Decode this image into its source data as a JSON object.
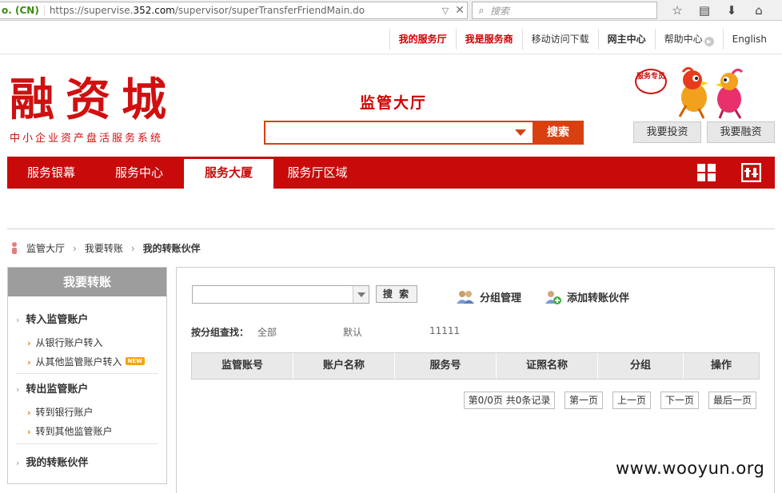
{
  "browser": {
    "cert_label": "o. (CN)",
    "url_prefix": "https://supervise.",
    "url_domain": "352.com",
    "url_suffix": "/supervisor/superTransferFriendMain.do",
    "search_placeholder": "搜索"
  },
  "top_links": [
    "我的服务厅",
    "我是服务商",
    "移动访问下载",
    "网主中心",
    "帮助中心",
    "English"
  ],
  "logo": {
    "title": "融资城",
    "subtitle": "中小企业资产盘活服务系统"
  },
  "header": {
    "hall_title": "监管大厅",
    "search_button": "搜索",
    "service_badge": "服务专员",
    "invest_button": "我要投资",
    "finance_button": "我要融资"
  },
  "nav": {
    "tabs": [
      "服务银幕",
      "服务中心",
      "服务大厦",
      "服务厅区域"
    ],
    "active_index": 2
  },
  "breadcrumb": [
    "监管大厅",
    "我要转账",
    "我的转账伙伴"
  ],
  "sidebar": {
    "title": "我要转账",
    "group_in": "转入监管账户",
    "in_bank": "从银行账户转入",
    "in_other": "从其他监管账户转入",
    "new_badge": "NEW",
    "group_out": "转出监管账户",
    "out_bank": "转到银行账户",
    "out_other": "转到其他监管账户",
    "partners": "我的转账伙伴"
  },
  "content": {
    "search_button": "搜 索",
    "group_manage": "分组管理",
    "add_partner": "添加转账伙伴",
    "filter_label": "按分组查找：",
    "filter_options": [
      "全部",
      "默认",
      "11111"
    ],
    "columns": [
      "监管账号",
      "账户名称",
      "服务号",
      "证照名称",
      "分组",
      "操作"
    ],
    "pager": {
      "summary": "第0/0页 共0条记录",
      "first": "第一页",
      "prev": "上一页",
      "next": "下一页",
      "last": "最后一页"
    }
  },
  "watermark": "www.wooyun.org",
  "colors": {
    "brand_red": "#c80a0a",
    "search_orange": "#d9400f",
    "sidebar_head": "#9d9d9d"
  }
}
